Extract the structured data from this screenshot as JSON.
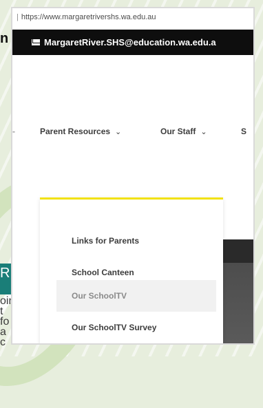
{
  "browser": {
    "url": "https://www.margaretrivershs.wa.edu.au"
  },
  "header": {
    "email_icon": "envelope-icon",
    "email": "MargaretRiver.SHS@education.wa.edu.a"
  },
  "nav": {
    "items": [
      {
        "label": "Parent Resources",
        "chevron": "⌄"
      },
      {
        "label": "Our Staff",
        "chevron": "⌄"
      },
      {
        "label": "S"
      }
    ]
  },
  "dropdown": {
    "items": [
      {
        "label": "Links for Parents"
      },
      {
        "label": "School Canteen"
      },
      {
        "label": "Our SchoolTV"
      },
      {
        "label": "Our SchoolTV Survey"
      }
    ],
    "accent_color": "#f2e20a"
  },
  "background_page": {
    "heading_fragment": "RE",
    "line_fragments": [
      "oin",
      "t fo",
      "a c"
    ],
    "edge_letter": "n"
  }
}
